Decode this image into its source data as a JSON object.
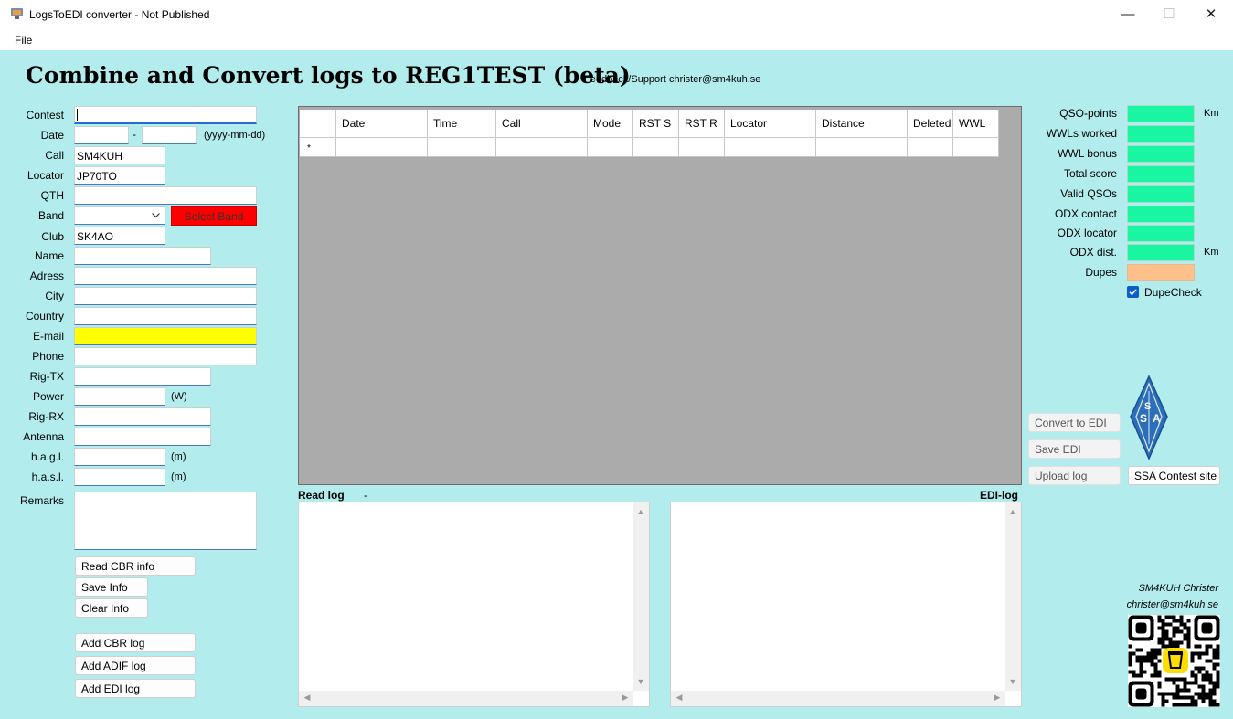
{
  "window": {
    "title": "LogsToEDI converter - Not Published",
    "minimize": "—",
    "maximize": "☐",
    "close": "✕"
  },
  "menu": {
    "file": "File"
  },
  "header": {
    "title": "Combine and Convert logs to REG1TEST (beta)",
    "feedback": "Feedback/Support christer@sm4kuh.se"
  },
  "form": {
    "contest": {
      "label": "Contest",
      "value": ""
    },
    "date": {
      "label": "Date",
      "from": "",
      "separator": "-",
      "to": "",
      "format_hint": "(yyyy-mm-dd)"
    },
    "call": {
      "label": "Call",
      "value": "SM4KUH"
    },
    "locator": {
      "label": "Locator",
      "value": "JP70TO"
    },
    "qth": {
      "label": "QTH",
      "value": ""
    },
    "band": {
      "label": "Band",
      "value": "",
      "select_button": "Select Band"
    },
    "club": {
      "label": "Club",
      "value": "SK4AO"
    },
    "name": {
      "label": "Name",
      "value": ""
    },
    "adress": {
      "label": "Adress",
      "value": ""
    },
    "city": {
      "label": "City",
      "value": ""
    },
    "country": {
      "label": "Country",
      "value": ""
    },
    "email": {
      "label": "E-mail",
      "value": ""
    },
    "phone": {
      "label": "Phone",
      "value": ""
    },
    "rig_tx": {
      "label": "Rig-TX",
      "value": ""
    },
    "power": {
      "label": "Power",
      "value": "",
      "unit": "(W)"
    },
    "rig_rx": {
      "label": "Rig-RX",
      "value": ""
    },
    "antenna": {
      "label": "Antenna",
      "value": ""
    },
    "hagl": {
      "label": "h.a.g.l.",
      "value": "",
      "unit": "(m)"
    },
    "hasl": {
      "label": "h.a.s.l.",
      "value": "",
      "unit": "(m)"
    },
    "remarks": {
      "label": "Remarks",
      "value": ""
    }
  },
  "buttons": {
    "read_cbr_info": "Read CBR info",
    "save_info": "Save Info",
    "clear_info": "Clear Info",
    "add_cbr_log": "Add CBR log",
    "add_adif_log": "Add ADIF log",
    "add_edi_log": "Add EDI log",
    "convert_to_edi": "Convert to EDI",
    "save_edi": "Save EDI",
    "upload_log": "Upload log",
    "ssa_contest_site": "SSA Contest site"
  },
  "grid": {
    "columns": [
      "Date",
      "Time",
      "Call",
      "Mode",
      "RST S",
      "RST R",
      "Locator",
      "Distance",
      "Deleted",
      "WWL"
    ],
    "new_row_marker": "*"
  },
  "logs": {
    "read_label": "Read log",
    "read_dash": "-",
    "edi_label": "EDI-log"
  },
  "stats": {
    "qso_points": {
      "label": "QSO-points",
      "unit": "Km"
    },
    "wwls_worked": {
      "label": "WWLs worked"
    },
    "wwl_bonus": {
      "label": "WWL bonus"
    },
    "total_score": {
      "label": "Total score"
    },
    "valid_qsos": {
      "label": "Valid QSOs"
    },
    "odx_contact": {
      "label": "ODX contact"
    },
    "odx_locator": {
      "label": "ODX locator"
    },
    "odx_dist": {
      "label": "ODX dist.",
      "unit": "Km"
    },
    "dupes": {
      "label": "Dupes"
    },
    "dupecheck": {
      "label": "DupeCheck",
      "checked": true
    }
  },
  "credits": {
    "name": "SM4KUH Christer",
    "email": "christer@sm4kuh.se"
  },
  "logo": {
    "letters": "SSA"
  },
  "colors": {
    "background": "#b2ecec",
    "stat_field": "#19f5a0",
    "dupes_field": "#ffc08a",
    "email_field": "#ffff00",
    "band_button": "#ff0000",
    "grid_bg": "#ababab"
  }
}
